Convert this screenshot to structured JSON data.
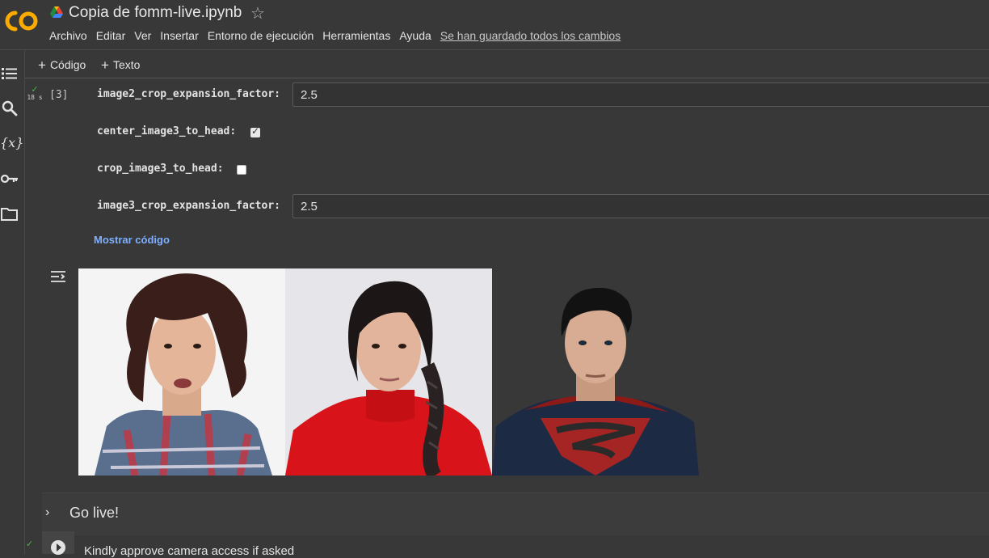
{
  "header": {
    "logo_text": "CO",
    "title": "Copia de fomm-live.ipynb",
    "star_icon": "star-outline-icon",
    "menu": [
      "Archivo",
      "Editar",
      "Ver",
      "Insertar",
      "Entorno de ejecución",
      "Herramientas",
      "Ayuda"
    ],
    "save_status": "Se han guardado todos los cambios"
  },
  "rail": {
    "icons": [
      "table-of-contents-icon",
      "search-icon",
      "variables-icon",
      "key-icon",
      "folder-icon"
    ],
    "variables_glyph": "{x}"
  },
  "toolbar": {
    "add_code_label": "Código",
    "add_text_label": "Texto"
  },
  "cell": {
    "duration": "18 s",
    "exec_count": "[3]",
    "fields": {
      "image2_label": "image2_crop_expansion_factor:",
      "image2_value": "2.5",
      "center3_label": "center_image3_to_head:",
      "center3_checked": true,
      "crop3_label": "crop_image3_to_head:",
      "crop3_checked": false,
      "image3_label": "image3_crop_expansion_factor:",
      "image3_value": "2.5"
    },
    "show_code": "Mostrar código"
  },
  "output": {
    "images": [
      "curly-haired-woman-portrait",
      "woman-with-braid-portrait",
      "superhero-portrait"
    ]
  },
  "section": {
    "title": "Go live!"
  },
  "next_cell": {
    "text": "Kindly approve camera access if asked"
  },
  "colors": {
    "background": "#383838",
    "accent_link": "#7fb0ff",
    "logo_orange": "#f9ab00",
    "success": "#4caf50"
  }
}
